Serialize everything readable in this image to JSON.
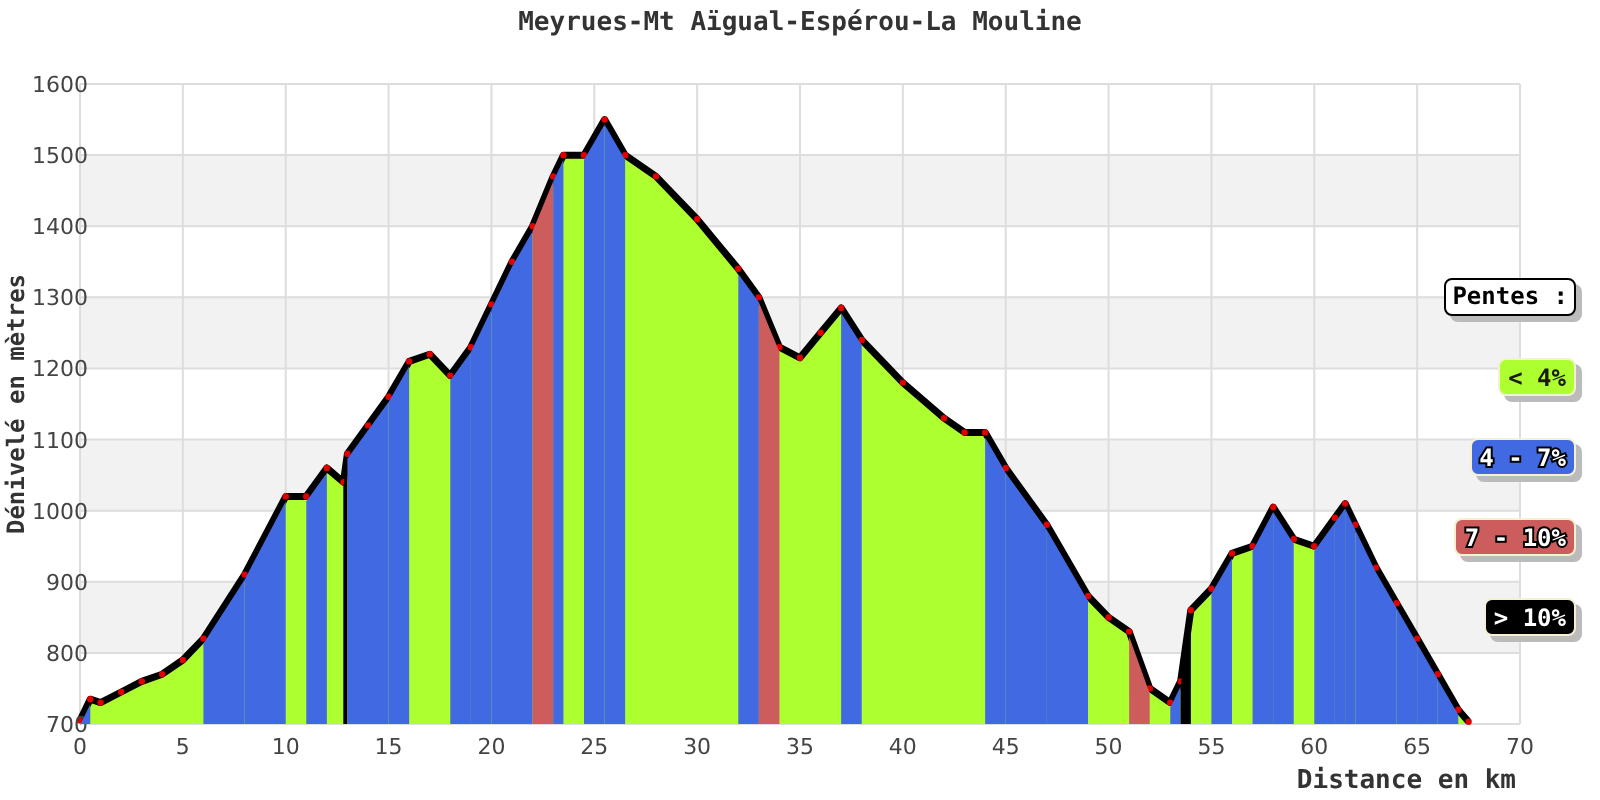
{
  "chart_data": {
    "type": "area",
    "title": "Meyrues-Mt Aïgual-Espérou-La Mouline",
    "xlabel": "Distance en km",
    "ylabel": "Dénivelé en mètres",
    "x": [
      0,
      0.5,
      1,
      2,
      3,
      4,
      5,
      6,
      8,
      10,
      11,
      12,
      12.8,
      13,
      14,
      15,
      16,
      17,
      18,
      19,
      20,
      21,
      22,
      23,
      23.5,
      24.5,
      25.5,
      26.5,
      28,
      30,
      32,
      33,
      34,
      35,
      36,
      37,
      38,
      40,
      42,
      43,
      44,
      45,
      47,
      49,
      50,
      51,
      52,
      53,
      53.5,
      54,
      55,
      56,
      57,
      58,
      59,
      60,
      61,
      61.5,
      62,
      63,
      64,
      65,
      66,
      67,
      67.5
    ],
    "grid": true,
    "series": [
      {
        "color": "#000000",
        "values": [
          705,
          735,
          730,
          745,
          760,
          770,
          790,
          820,
          910,
          1020,
          1020,
          1060,
          1040,
          1080,
          1120,
          1160,
          1210,
          1220,
          1190,
          1230,
          1290,
          1350,
          1400,
          1470,
          1500,
          1500,
          1550,
          1500,
          1470,
          1410,
          1340,
          1300,
          1230,
          1215,
          1250,
          1285,
          1240,
          1180,
          1130,
          1110,
          1110,
          1060,
          980,
          880,
          850,
          830,
          750,
          730,
          760,
          860,
          890,
          940,
          950,
          1005,
          960,
          950,
          990,
          1010,
          980,
          920,
          870,
          820,
          770,
          720,
          703
        ]
      }
    ],
    "xlim": [
      0,
      70
    ],
    "ylim": [
      700,
      1600
    ],
    "xticks": [
      0,
      5,
      10,
      15,
      20,
      25,
      30,
      35,
      40,
      45,
      50,
      55,
      60,
      65,
      70
    ],
    "yticks": [
      700,
      800,
      900,
      1000,
      1100,
      1200,
      1300,
      1400,
      1500,
      1600
    ]
  },
  "legend": {
    "title": "Pentes :",
    "items": [
      {
        "label": "< 4%",
        "color": "#adff2f"
      },
      {
        "label": "4 - 7%",
        "color": "#4169e1"
      },
      {
        "label": "7 - 10%",
        "color": "#cd5c5c"
      },
      {
        "label": "> 10%",
        "color": "#000000"
      }
    ]
  }
}
